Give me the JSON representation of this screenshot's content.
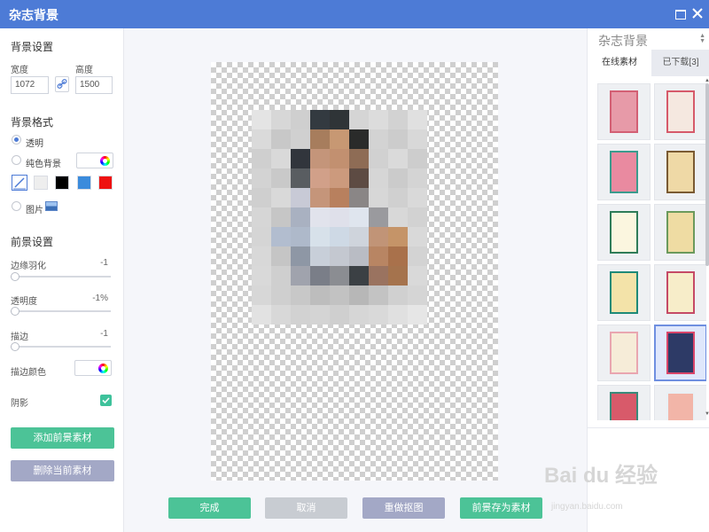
{
  "window": {
    "title": "杂志背景"
  },
  "left": {
    "bg_settings_title": "背景设置",
    "width_label": "宽度",
    "height_label": "高度",
    "width_value": "1072",
    "height_value": "1500",
    "bg_format_title": "背景格式",
    "opt_transparent": "透明",
    "opt_solid": "纯色背景",
    "opt_image": "图片",
    "swatches": [
      "#eeeeee",
      "#000000",
      "#3b8bdc",
      "#ee1111"
    ],
    "fg_settings_title": "前景设置",
    "edge_feather_label": "边缘羽化",
    "edge_feather_value": "-1",
    "opacity_label": "透明度",
    "opacity_value": "-1%",
    "stroke_label": "描边",
    "stroke_value": "-1",
    "stroke_color_label": "描边颜色",
    "shadow_label": "阴影",
    "shadow_checked": true,
    "add_fg_btn": "添加前景素材",
    "delete_fg_btn": "删除当前素材"
  },
  "right": {
    "header": "杂志背景",
    "tab_online": "在线素材",
    "tab_downloaded": "已下载[3]",
    "selected_index": 9
  },
  "bottom": {
    "done": "完成",
    "cancel": "取消",
    "recut": "重做抠图",
    "save_fg": "前景存为素材"
  },
  "watermark": {
    "brand": "Bai du 经验",
    "url": "jingyan.baidu.com"
  }
}
